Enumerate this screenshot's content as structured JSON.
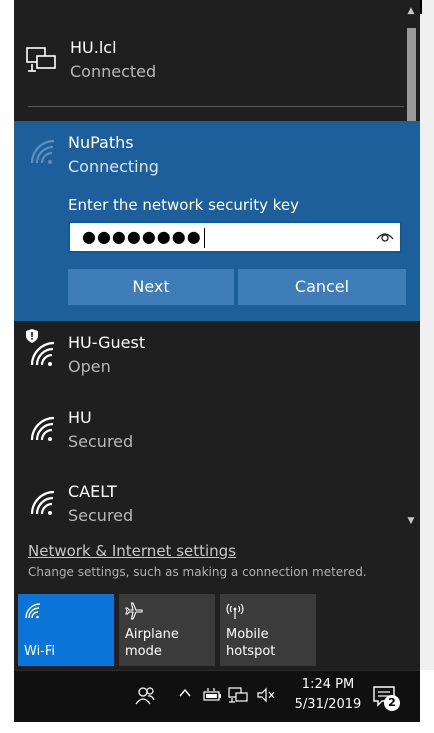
{
  "ethernet": {
    "name": "HU.lcl",
    "status": "Connected",
    "icon": "ethernet-icon"
  },
  "active_network": {
    "name": "NuPaths",
    "status": "Connecting",
    "key_label": "Enter the network security key",
    "key_value": "●●●●●●●●",
    "next_label": "Next",
    "cancel_label": "Cancel",
    "icon": "wifi-icon"
  },
  "networks": [
    {
      "name": "HU-Guest",
      "status": "Open",
      "icon": "wifi-shield-icon"
    },
    {
      "name": "HU",
      "status": "Secured",
      "icon": "wifi-icon"
    },
    {
      "name": "CAELT",
      "status": "Secured",
      "icon": "wifi-icon"
    }
  ],
  "settings": {
    "link": "Network & Internet settings",
    "description": "Change settings, such as making a connection metered."
  },
  "tiles": [
    {
      "label": "Wi-Fi",
      "icon": "wifi-icon",
      "active": true
    },
    {
      "label": "Airplane mode",
      "icon": "airplane-icon",
      "active": false
    },
    {
      "label": "Mobile hotspot",
      "icon": "hotspot-icon",
      "active": false
    }
  ],
  "taskbar": {
    "time": "1:24 PM",
    "date": "5/31/2019",
    "notification_count": "2"
  },
  "colors": {
    "flyout_bg": "#1f1f1f",
    "active_panel": "#1d5f9a",
    "button": "#3f7db8",
    "accent_tile": "#0a74d9"
  }
}
